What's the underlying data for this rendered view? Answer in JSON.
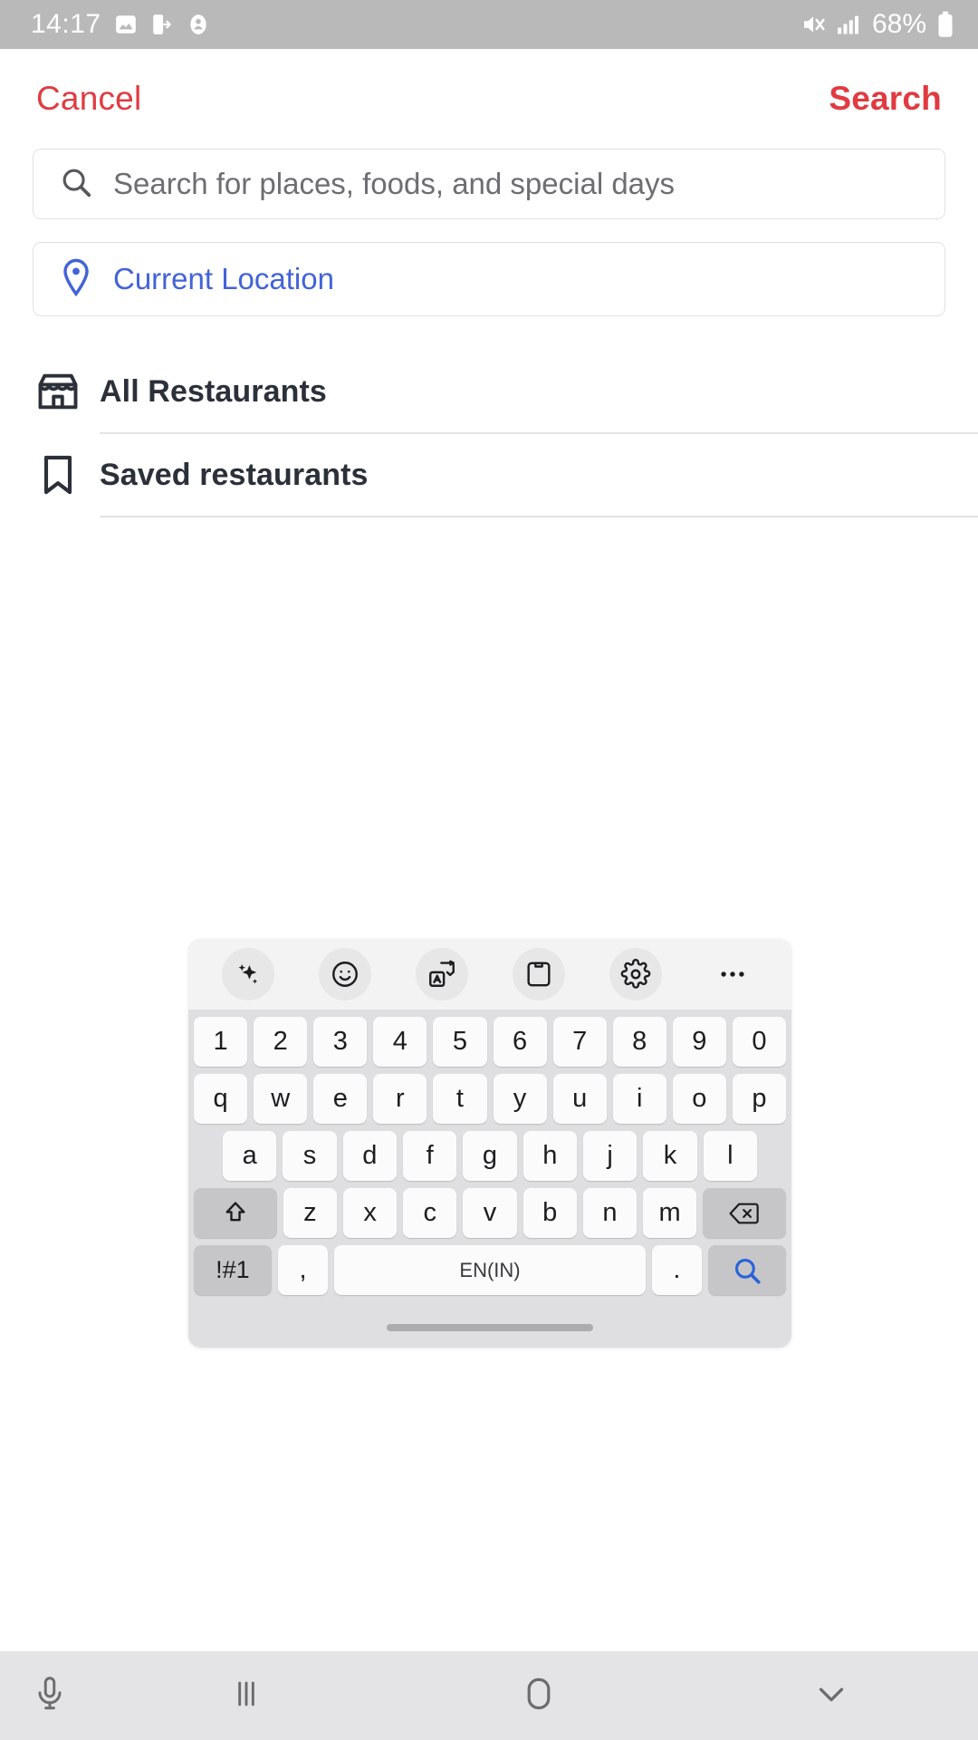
{
  "status_bar": {
    "time": "14:17",
    "battery_percent": "68%",
    "left_icons": [
      "image-icon",
      "file-transfer-icon",
      "contact-icon"
    ],
    "right_icons": [
      "mute-icon",
      "signal-icon",
      "battery-icon"
    ],
    "background_color": "#b9b9b9",
    "text_color": "#ffffff"
  },
  "header": {
    "cancel_label": "Cancel",
    "search_label": "Search",
    "accent_color": "#e03b41"
  },
  "search": {
    "placeholder": "Search for places, foods, and special days",
    "value": "",
    "icon": "search-icon"
  },
  "location": {
    "label": "Current Location",
    "icon": "location-pin-icon",
    "color": "#4263d8"
  },
  "menu": {
    "items": [
      {
        "label": "All Restaurants",
        "icon": "storefront-icon"
      },
      {
        "label": "Saved restaurants",
        "icon": "bookmark-icon"
      }
    ]
  },
  "keyboard": {
    "toolbar_icons": [
      "sparkle-ai-icon",
      "emoji-icon",
      "translate-icon",
      "clipboard-icon",
      "gear-icon",
      "more-options-icon"
    ],
    "rows": {
      "numbers": [
        "1",
        "2",
        "3",
        "4",
        "5",
        "6",
        "7",
        "8",
        "9",
        "0"
      ],
      "letters_row1": [
        "q",
        "w",
        "e",
        "r",
        "t",
        "y",
        "u",
        "i",
        "o",
        "p"
      ],
      "letters_row2": [
        "a",
        "s",
        "d",
        "f",
        "g",
        "h",
        "j",
        "k",
        "l"
      ],
      "letters_row3": [
        "z",
        "x",
        "c",
        "v",
        "b",
        "n",
        "m"
      ]
    },
    "shift_key": "shift-icon",
    "backspace_key": "backspace-icon",
    "symbols_key": "!#1",
    "comma_key": ",",
    "space_key": "EN(IN)",
    "period_key": ".",
    "enter_key": "search-enter-icon",
    "handle": "keyboard-resize-handle"
  },
  "nav_bar": {
    "items": [
      {
        "icon": "microphone-icon"
      },
      {
        "icon": "recents-icon"
      },
      {
        "icon": "home-icon"
      },
      {
        "icon": "hide-keyboard-icon"
      }
    ],
    "background_color": "#e4e4e6"
  }
}
